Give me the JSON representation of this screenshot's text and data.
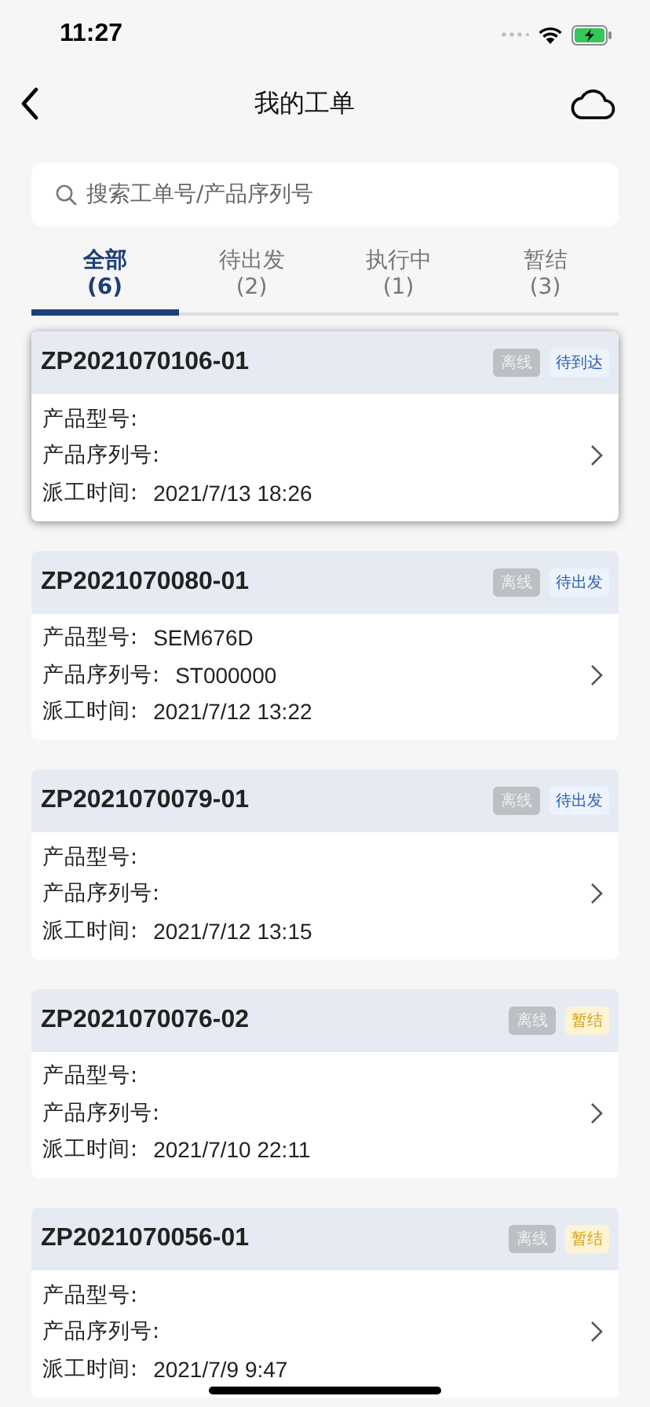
{
  "status_bar": {
    "time": "11:27"
  },
  "nav": {
    "title": "我的工单"
  },
  "search": {
    "placeholder": "搜索工单号/产品序列号"
  },
  "tabs": [
    {
      "label": "全部",
      "count": "(6)",
      "selected": true
    },
    {
      "label": "待出发",
      "count": "(2)",
      "selected": false
    },
    {
      "label": "执行中",
      "count": "(1)",
      "selected": false
    },
    {
      "label": "暂结",
      "count": "(3)",
      "selected": false
    }
  ],
  "orders": [
    {
      "number": "ZP2021070106-01",
      "selected": true,
      "offline_tag": "离线",
      "status": {
        "label": "待到达",
        "kind": "pending"
      },
      "fields": [
        {
          "label": "产品型号:"
        },
        {
          "label": "产品序列号:"
        },
        {
          "label": "派工时间:",
          "value": "2021/7/13 18:26"
        }
      ]
    },
    {
      "number": "ZP2021070080-01",
      "selected": false,
      "offline_tag": "离线",
      "status": {
        "label": "待出发",
        "kind": "pending"
      },
      "fields": [
        {
          "label": "产品型号:",
          "value": "SEM676D"
        },
        {
          "label": "产品序列号:",
          "value": "ST000000"
        },
        {
          "label": "派工时间:",
          "value": "2021/7/12 13:22"
        }
      ]
    },
    {
      "number": "ZP2021070079-01",
      "selected": false,
      "offline_tag": "离线",
      "status": {
        "label": "待出发",
        "kind": "pending"
      },
      "fields": [
        {
          "label": "产品型号:"
        },
        {
          "label": "产品序列号:"
        },
        {
          "label": "派工时间:",
          "value": "2021/7/12 13:15"
        }
      ]
    },
    {
      "number": "ZP2021070076-02",
      "selected": false,
      "offline_tag": "离线",
      "status": {
        "label": "暂结",
        "kind": "paused"
      },
      "fields": [
        {
          "label": "产品型号:"
        },
        {
          "label": "产品序列号:"
        },
        {
          "label": "派工时间:",
          "value": "2021/7/10 22:11"
        }
      ]
    },
    {
      "number": "ZP2021070056-01",
      "selected": false,
      "offline_tag": "离线",
      "status": {
        "label": "暂结",
        "kind": "paused"
      },
      "fields": [
        {
          "label": "产品型号:"
        },
        {
          "label": "产品序列号:"
        },
        {
          "label": "派工时间:",
          "value": "2021/7/9 9:47"
        }
      ]
    }
  ]
}
